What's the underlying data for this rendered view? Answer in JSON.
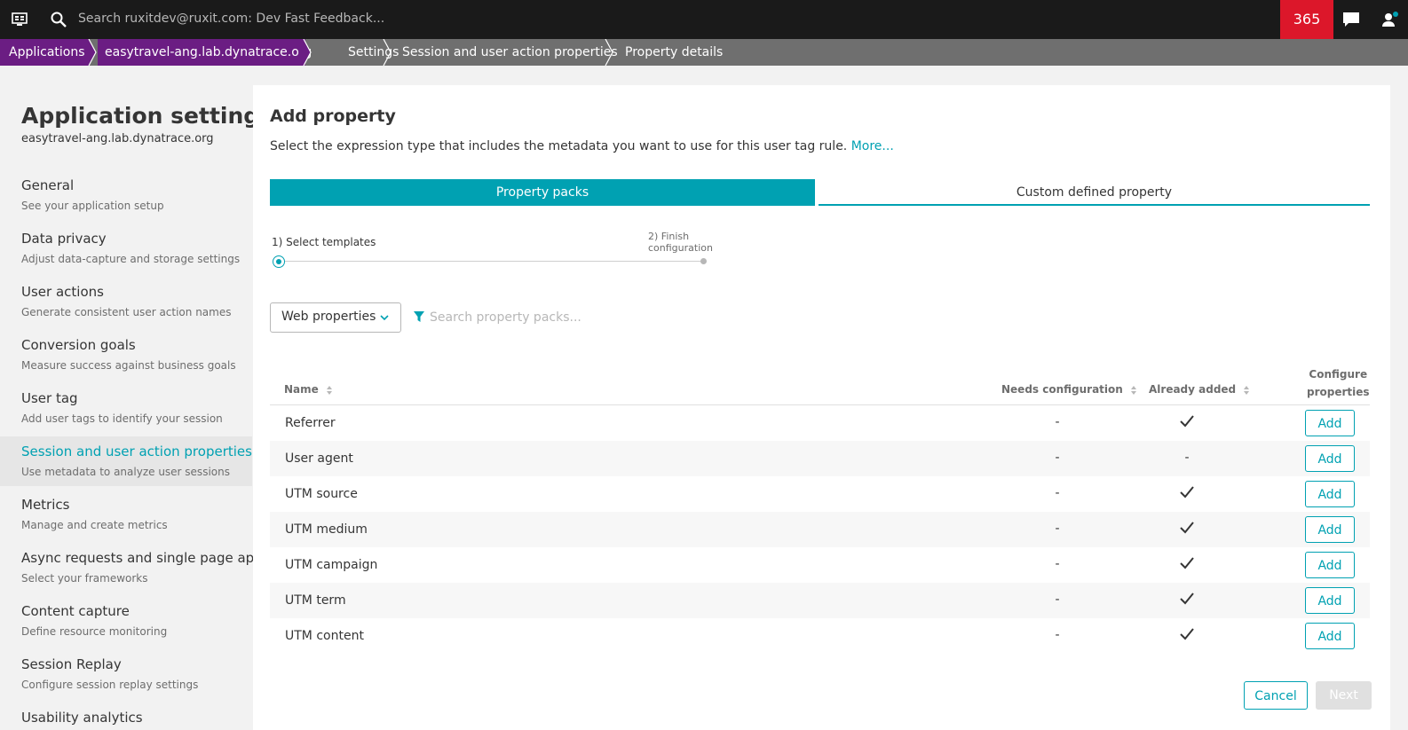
{
  "topbar": {
    "search_text": "Search ruxitdev@ruxit.com: Dev Fast Feedback...",
    "notification_count": "365",
    "icons": [
      "screen-menu-icon",
      "search-icon",
      "chat-icon",
      "user-icon"
    ]
  },
  "breadcrumb": {
    "items": [
      "Applications",
      "easytravel-ang.lab.dynatrace.org",
      "Settings",
      "Session and user action properties",
      "Property details"
    ]
  },
  "sidebar": {
    "title": "Application settings",
    "subtitle": "easytravel-ang.lab.dynatrace.org",
    "items": [
      {
        "title": "General",
        "desc": "See your application setup"
      },
      {
        "title": "Data privacy",
        "desc": "Adjust data-capture and storage settings"
      },
      {
        "title": "User actions",
        "desc": "Generate consistent user action names"
      },
      {
        "title": "Conversion goals",
        "desc": "Measure success against business goals"
      },
      {
        "title": "User tag",
        "desc": "Add user tags to identify your session"
      },
      {
        "title": "Session and user action properties",
        "desc": "Use metadata to analyze user sessions"
      },
      {
        "title": "Metrics",
        "desc": "Manage and create metrics"
      },
      {
        "title": "Async requests and single page apps",
        "desc": "Select your frameworks"
      },
      {
        "title": "Content capture",
        "desc": "Define resource monitoring"
      },
      {
        "title": "Session Replay",
        "desc": "Configure session replay settings"
      },
      {
        "title": "Usability analytics",
        "desc": ""
      }
    ],
    "active_index": 5
  },
  "main": {
    "heading": "Add property",
    "description": "Select the expression type that includes the metadata you want to use for this user tag rule.",
    "more_link": "More...",
    "tabs": [
      {
        "label": "Property packs",
        "active": true
      },
      {
        "label": "Custom defined property",
        "active": false
      }
    ],
    "steps": [
      {
        "label": "1) Select templates"
      },
      {
        "label_line1": "2) Finish",
        "label_line2": "configuration"
      }
    ],
    "filter": {
      "select_value": "Web properties",
      "search_placeholder": "Search property packs..."
    },
    "table": {
      "headers": {
        "name": "Name",
        "needs": "Needs configuration",
        "added": "Already added",
        "configure_line1": "Configure",
        "configure_line2": "properties"
      },
      "rows": [
        {
          "name": "Referrer",
          "needs": "-",
          "added": true
        },
        {
          "name": "User agent",
          "needs": "-",
          "added": false,
          "added_text": "-"
        },
        {
          "name": "UTM source",
          "needs": "-",
          "added": true
        },
        {
          "name": "UTM medium",
          "needs": "-",
          "added": true
        },
        {
          "name": "UTM campaign",
          "needs": "-",
          "added": true
        },
        {
          "name": "UTM term",
          "needs": "-",
          "added": true
        },
        {
          "name": "UTM content",
          "needs": "-",
          "added": true
        }
      ],
      "add_label": "Add"
    },
    "footer": {
      "cancel": "Cancel",
      "next": "Next"
    }
  },
  "colors": {
    "accent": "#00a1b2",
    "app_crumb": "#6b1d83",
    "counter_bg": "#dc172a",
    "topbar_bg": "#1a1a1a"
  }
}
